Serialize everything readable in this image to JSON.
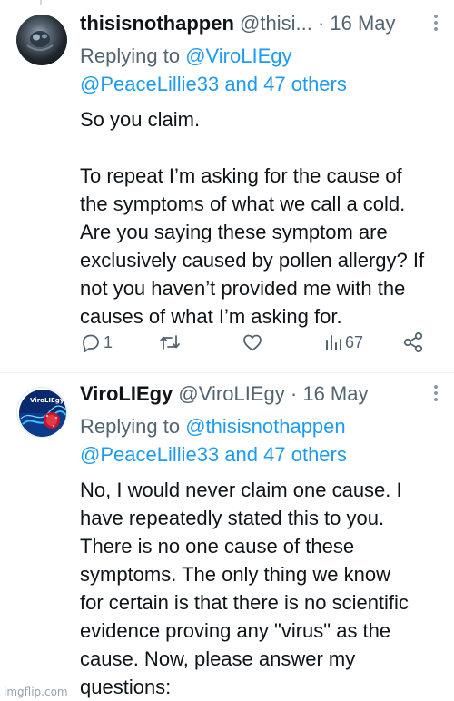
{
  "tweets": [
    {
      "name": "thisisnothappen",
      "handle": "@thisi...",
      "dot": "·",
      "time": "16 May",
      "replying_prefix": "Replying to ",
      "replying_user1": "@ViroLIEgy",
      "replying_line2": "@PeaceLillie33 and 47 others",
      "body": "So you claim.\n\nTo repeat I’m asking for the cause of\nthe symptoms of what we call a cold.\nAre you saying these symptom are\nexclusively caused by pollen allergy? If\nnot you haven’t provided me with the\ncauses of what I’m asking for.",
      "reply_count": "1",
      "retweet_count": "",
      "like_count": "",
      "view_count": "67"
    },
    {
      "name": "ViroLIEgy",
      "handle": "@ViroLIEgy",
      "dot": "·",
      "time": "16 May",
      "replying_prefix": "Replying to ",
      "replying_user1": "@thisisnothappen",
      "replying_line2": "@PeaceLillie33 and 47 others",
      "body": "No, I would never claim one cause. I\nhave repeatedly stated this to you.\nThere is no one cause of these\nsymptoms. The only thing we know\nfor certain is that there is no scientific\nevidence proving any \"virus\" as the\ncause. Now, please answer my\nquestions:",
      "avatar_text": "ViroLIEgy"
    }
  ],
  "watermark": "imgflip.com",
  "colors": {
    "link": "#1d9bf0",
    "secondary": "#536471",
    "primary": "#0f1419"
  }
}
